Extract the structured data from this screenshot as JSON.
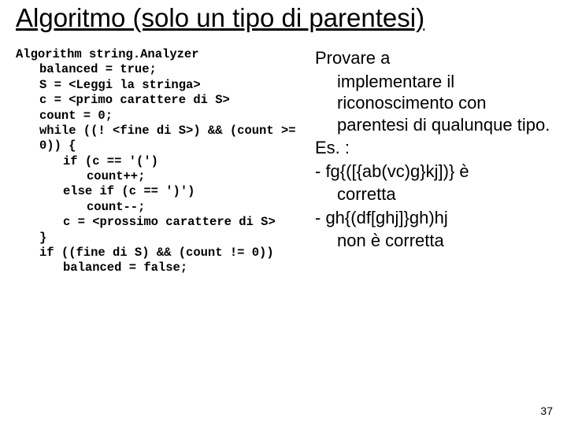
{
  "title": "Algoritmo (solo un tipo di parentesi)",
  "code": {
    "l0": "Algorithm string.Analyzer",
    "l1": "balanced = true;",
    "l2": "S = <Leggi la stringa>",
    "l3": "c = <primo carattere di S>",
    "l4": "count = 0;",
    "l5": "while ((! <fine di S>) && (count >= 0)) {",
    "l6": "if (c == '(')",
    "l7": "count++;",
    "l8": "else if (c == ')')",
    "l9": "count--;",
    "l10": "c = <prossimo carattere di S>",
    "l11": "}",
    "l12": "if ((fine di S) && (count != 0))",
    "l13": "balanced = false;"
  },
  "right": {
    "p1a": "Provare a",
    "p1b": "implementare il riconoscimento con parentesi di qualunque tipo.",
    "p2": "Es. :",
    "b1a": "- fg{([{ab(vc)g}kj])} è",
    "b1b": "corretta",
    "b2a": "- gh{(df[ghj]}gh)hj",
    "b2b": "non è corretta"
  },
  "page": "37"
}
